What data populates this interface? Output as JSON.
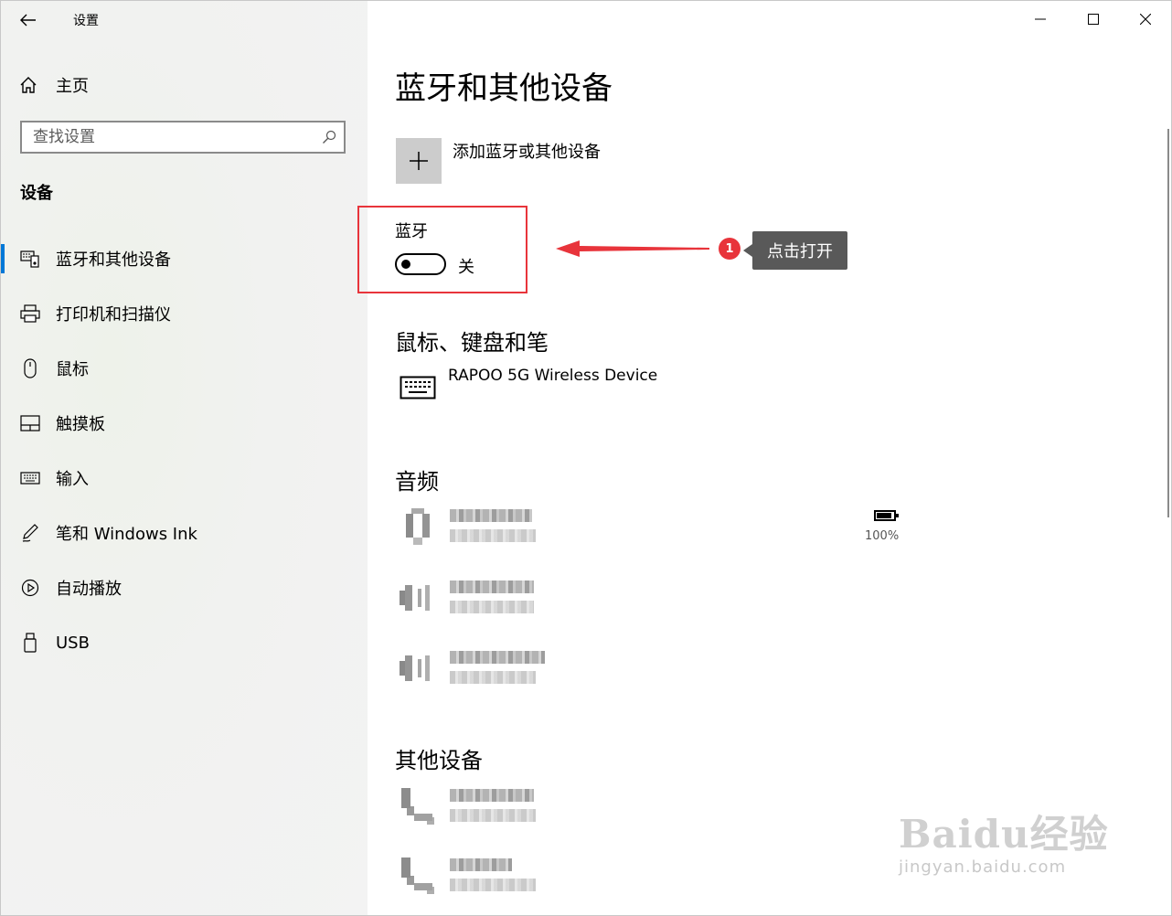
{
  "window": {
    "title": "设置",
    "controls": [
      "minimize",
      "maximize",
      "close"
    ]
  },
  "sidebar": {
    "home_label": "主页",
    "search_placeholder": "查找设置",
    "section_title": "设备",
    "items": [
      {
        "label": "蓝牙和其他设备",
        "icon": "bluetooth-devices-icon",
        "active": true
      },
      {
        "label": "打印机和扫描仪",
        "icon": "printer-icon",
        "active": false
      },
      {
        "label": "鼠标",
        "icon": "mouse-icon",
        "active": false
      },
      {
        "label": "触摸板",
        "icon": "touchpad-icon",
        "active": false
      },
      {
        "label": "输入",
        "icon": "keyboard-icon",
        "active": false
      },
      {
        "label": "笔和 Windows Ink",
        "icon": "pen-icon",
        "active": false
      },
      {
        "label": "自动播放",
        "icon": "autoplay-icon",
        "active": false
      },
      {
        "label": "USB",
        "icon": "usb-icon",
        "active": false
      }
    ]
  },
  "main": {
    "title": "蓝牙和其他设备",
    "add_device_label": "添加蓝牙或其他设备",
    "bluetooth": {
      "label": "蓝牙",
      "state_text": "关",
      "on": false
    },
    "annotation": {
      "badge": "1",
      "text": "点击打开"
    },
    "sections": {
      "mouse_keyboard_pen": {
        "title": "鼠标、键盘和笔",
        "devices": [
          {
            "name": "RAPOO 5G Wireless Device",
            "icon": "keyboard-icon"
          }
        ]
      },
      "audio": {
        "title": "音频",
        "battery_text": "100%",
        "battery_level": 1.0
      },
      "other": {
        "title": "其他设备"
      }
    }
  },
  "watermark": {
    "brand": "Baidu经验",
    "url": "jingyan.baidu.com"
  },
  "colors": {
    "accent": "#0078d7",
    "annotation_red": "#e8343b",
    "tooltip_bg": "#595959"
  }
}
